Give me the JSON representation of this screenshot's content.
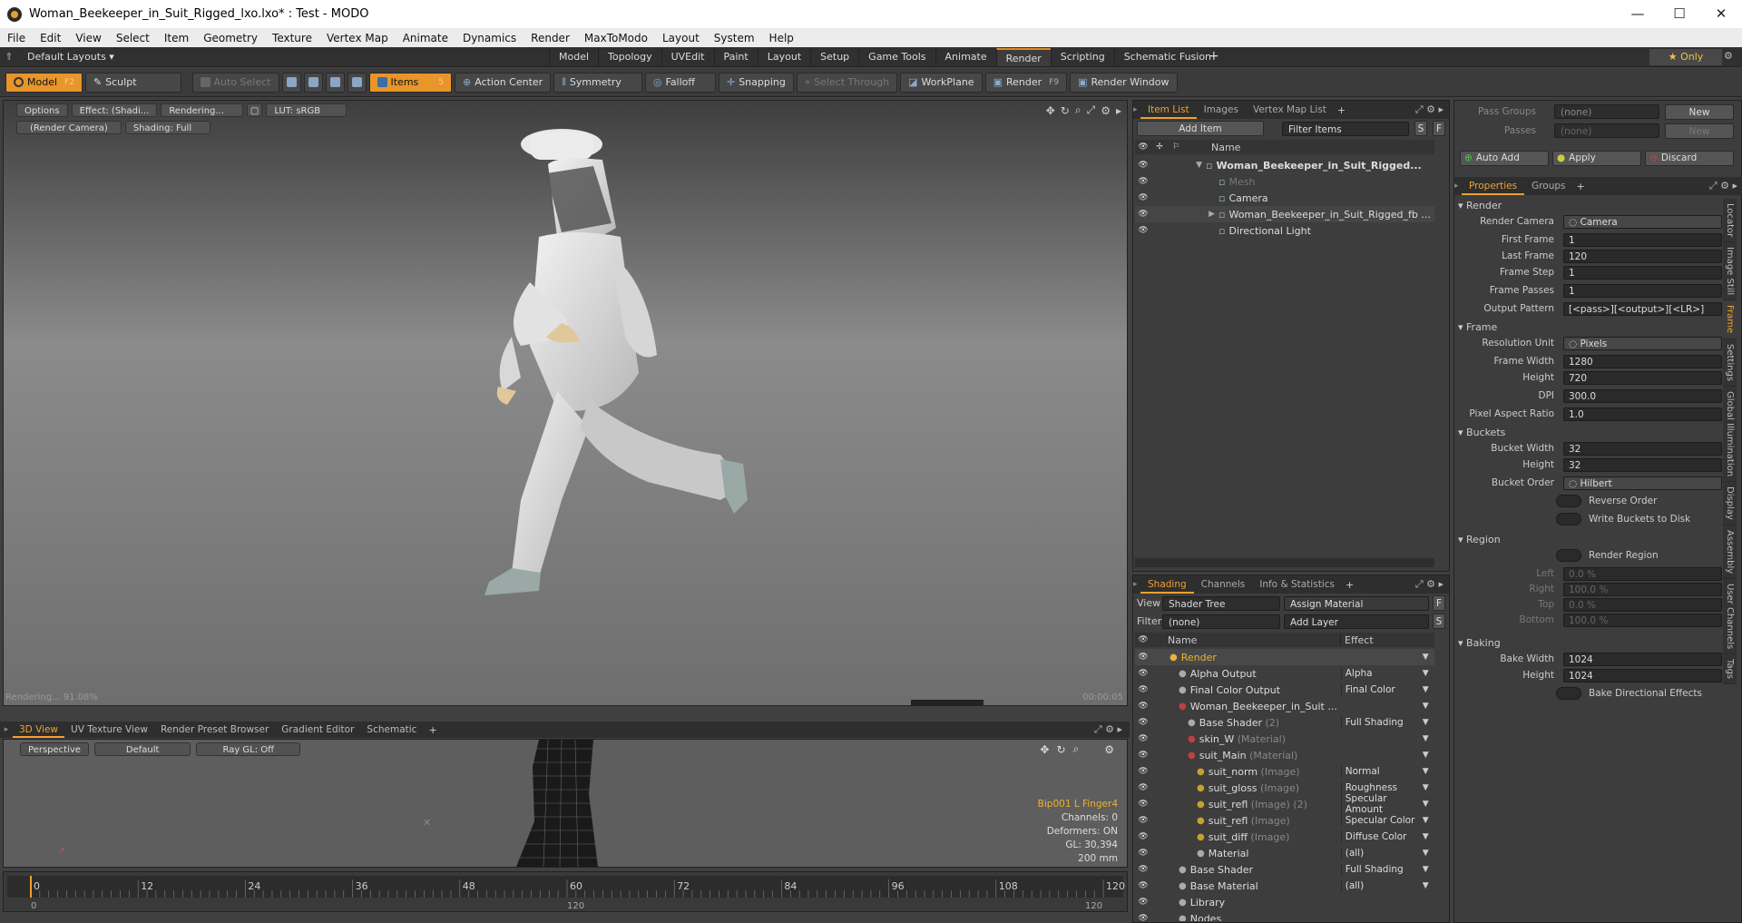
{
  "window": {
    "title": "Woman_Beekeeper_in_Suit_Rigged_lxo.lxo* : Test - MODO",
    "minimize": "—",
    "maximize": "☐",
    "close": "✕"
  },
  "menu": [
    "File",
    "Edit",
    "View",
    "Select",
    "Item",
    "Geometry",
    "Texture",
    "Vertex Map",
    "Animate",
    "Dynamics",
    "Render",
    "MaxToModo",
    "Layout",
    "System",
    "Help"
  ],
  "layouts": {
    "dropdown": "Default Layouts ▾",
    "tabs": [
      "Model",
      "Topology",
      "UVEdit",
      "Paint",
      "Layout",
      "Setup",
      "Game Tools",
      "Animate",
      "Render",
      "Scripting",
      "Schematic Fusion"
    ],
    "active": "Render",
    "add": "+",
    "only": "★ Only"
  },
  "toolbar": {
    "model": "Model",
    "model_key": "F2",
    "sculpt": "Sculpt",
    "auto_select": "Auto Select",
    "items": "Items",
    "items_key": "5",
    "action_center": "Action Center",
    "symmetry": "Symmetry",
    "falloff": "Falloff",
    "snapping": "Snapping",
    "select_through": "Select Through",
    "workplane": "WorkPlane",
    "render": "Render",
    "render_key": "F9",
    "render_window": "Render Window"
  },
  "viewport": {
    "options": "Options",
    "effect": "Effect: (Shadi...",
    "rendering": "Rendering...",
    "lut": "LUT: sRGB",
    "camera": "(Render Camera)",
    "shading": "Shading: Full",
    "status_left": "Rendering... 91.08%",
    "status_right": "00:00:05"
  },
  "view_tabs": {
    "tabs": [
      "3D View",
      "UV Texture View",
      "Render Preset Browser",
      "Gradient Editor",
      "Schematic"
    ],
    "active": "3D View",
    "add": "+"
  },
  "view3d": {
    "perspective": "Perspective",
    "default": "Default",
    "raygl": "Ray GL: Off",
    "info": [
      "Bip001 L Finger4",
      "Channels: 0",
      "Deformers: ON",
      "GL: 30,394",
      "200 mm"
    ]
  },
  "timeline": {
    "ticks": [
      "0",
      "12",
      "24",
      "36",
      "48",
      "60",
      "72",
      "84",
      "96",
      "108",
      "120"
    ],
    "bottom_start": "0",
    "bottom_mid": "120",
    "bottom_end": "120"
  },
  "item_list": {
    "tabs": [
      "Item List",
      "Images",
      "Vertex Map List"
    ],
    "active": "Item List",
    "add": "+",
    "add_item": "Add Item",
    "filter": "Filter Items",
    "s": "S",
    "f": "F",
    "col_name": "Name",
    "items": [
      {
        "name": "Woman_Beekeeper_in_Suit_Rigged...",
        "indent": 0,
        "bold": true,
        "arrow": "▼"
      },
      {
        "name": "Mesh",
        "indent": 1,
        "dim": true,
        "arrow": ""
      },
      {
        "name": "Camera",
        "indent": 1,
        "arrow": ""
      },
      {
        "name": "Woman_Beekeeper_in_Suit_Rigged_fb ...",
        "indent": 1,
        "arrow": "▶"
      },
      {
        "name": "Directional Light",
        "indent": 1,
        "arrow": ""
      }
    ]
  },
  "shading": {
    "tabs": [
      "Shading",
      "Channels",
      "Info & Statistics"
    ],
    "active": "Shading",
    "add": "+",
    "view_label": "View",
    "view_value": "Shader Tree",
    "assign": "Assign Material",
    "f": "F",
    "filter_label": "Filter",
    "filter_value": "(none)",
    "add_layer": "Add Layer",
    "s": "S",
    "col_name": "Name",
    "col_effect": "Effect",
    "rows": [
      {
        "name": "Render",
        "sub": "",
        "effect": "",
        "indent": 0,
        "orange": true
      },
      {
        "name": "Alpha Output",
        "sub": "",
        "effect": "Alpha",
        "indent": 1
      },
      {
        "name": "Final Color Output",
        "sub": "",
        "effect": "Final Color",
        "indent": 1
      },
      {
        "name": "Woman_Beekeeper_in_Suit ...",
        "sub": "",
        "effect": "",
        "indent": 1
      },
      {
        "name": "Base Shader",
        "sub": "(2)",
        "effect": "Full Shading",
        "indent": 2
      },
      {
        "name": "skin_W",
        "sub": "(Material)",
        "effect": "",
        "indent": 2
      },
      {
        "name": "suit_Main",
        "sub": "(Material)",
        "effect": "",
        "indent": 2
      },
      {
        "name": "suit_norm",
        "sub": "(Image)",
        "effect": "Normal",
        "indent": 3
      },
      {
        "name": "suit_gloss",
        "sub": "(Image)",
        "effect": "Roughness",
        "indent": 3
      },
      {
        "name": "suit_refl",
        "sub": "(Image) (2)",
        "effect": "Specular Amount",
        "indent": 3
      },
      {
        "name": "suit_refl",
        "sub": "(Image)",
        "effect": "Specular Color",
        "indent": 3
      },
      {
        "name": "suit_diff",
        "sub": "(Image)",
        "effect": "Diffuse Color",
        "indent": 3
      },
      {
        "name": "Material",
        "sub": "",
        "effect": "(all)",
        "indent": 3
      },
      {
        "name": "Base Shader",
        "sub": "",
        "effect": "Full Shading",
        "indent": 1
      },
      {
        "name": "Base Material",
        "sub": "",
        "effect": "(all)",
        "indent": 1
      },
      {
        "name": "Library",
        "sub": "",
        "effect": "",
        "indent": 1
      },
      {
        "name": "Nodes",
        "sub": "",
        "effect": "",
        "indent": 1
      }
    ]
  },
  "passes": {
    "pass_groups": "Pass Groups",
    "pass_groups_value": "(none)",
    "new": "New",
    "passes": "Passes",
    "passes_value": "(none)",
    "new2": "New",
    "auto_add": "Auto Add",
    "apply": "Apply",
    "discard": "Discard"
  },
  "properties": {
    "tabs": [
      "Properties",
      "Groups"
    ],
    "active": "Properties",
    "add": "+",
    "side_tabs": [
      "Locator",
      "Image Still",
      "Frame",
      "Settings",
      "Global Illumination",
      "Display",
      "Assembly",
      "User Channels",
      "Tags"
    ],
    "side_active": "Frame",
    "render_head": "Render",
    "render_camera": "Render Camera",
    "render_camera_value": "Camera",
    "first_frame": "First Frame",
    "first_frame_value": "1",
    "last_frame": "Last Frame",
    "last_frame_value": "120",
    "frame_step": "Frame Step",
    "frame_step_value": "1",
    "frame_passes": "Frame Passes",
    "frame_passes_value": "1",
    "output_pattern": "Output Pattern",
    "output_pattern_value": "[<pass>][<output>][<LR>]",
    "frame_head": "Frame",
    "resolution_unit": "Resolution Unit",
    "resolution_unit_value": "Pixels",
    "frame_width": "Frame Width",
    "frame_width_value": "1280",
    "height": "Height",
    "height_value": "720",
    "dpi": "DPI",
    "dpi_value": "300.0",
    "pixel_aspect": "Pixel Aspect Ratio",
    "pixel_aspect_value": "1.0",
    "buckets_head": "Buckets",
    "bucket_width": "Bucket Width",
    "bucket_width_value": "32",
    "bucket_height": "Height",
    "bucket_height_value": "32",
    "bucket_order": "Bucket Order",
    "bucket_order_value": "Hilbert",
    "reverse_order": "Reverse Order",
    "write_buckets": "Write Buckets to Disk",
    "region_head": "Region",
    "render_region": "Render Region",
    "left": "Left",
    "left_value": "0.0 %",
    "right": "Right",
    "right_value": "100.0 %",
    "top": "Top",
    "top_value": "0.0 %",
    "bottom": "Bottom",
    "bottom_value": "100.0 %",
    "baking_head": "Baking",
    "bake_width": "Bake Width",
    "bake_width_value": "1024",
    "bake_height": "Height",
    "bake_height_value": "1024",
    "bake_directional": "Bake Directional Effects"
  }
}
